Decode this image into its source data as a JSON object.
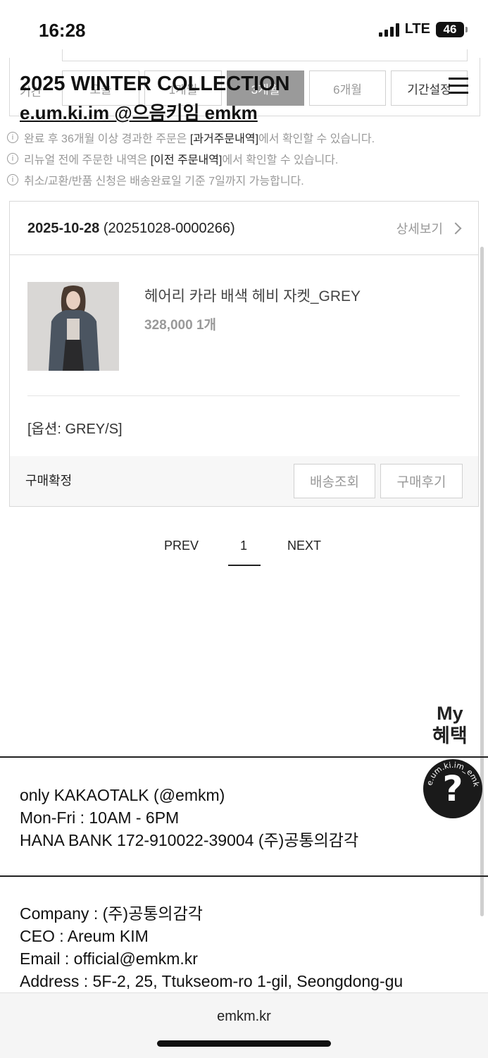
{
  "status_bar": {
    "time": "16:28",
    "network": "LTE",
    "battery": "46"
  },
  "header": {
    "title": "2025 WINTER COLLECTION",
    "subtitle": "e.um.ki.im @으음키임 emkm"
  },
  "period_filter": {
    "label": "기간",
    "options": [
      "오늘",
      "1개월",
      "3개월",
      "6개월",
      "기간설정"
    ],
    "selected": "3개월"
  },
  "notes": [
    {
      "pre": "완료 후 36개월 이상 경과한 주문은 ",
      "link": "[과거주문내역]",
      "post": "에서 확인할 수 있습니다."
    },
    {
      "pre": "리뉴얼 전에 주문한 내역은 ",
      "link": "[이전 주문내역]",
      "post": "에서 확인할 수 있습니다."
    },
    {
      "pre": "취소/교환/반품 신청은 배송완료일 기준 7일까지 가능합니다.",
      "link": "",
      "post": ""
    }
  ],
  "order": {
    "date": "2025-10-28",
    "order_number": "(20251028-0000266)",
    "detail_label": "상세보기",
    "product_name": "헤어리 카라 배색 헤비 자켓_GREY",
    "price": "328,000",
    "quantity": "1개",
    "option": "[옵션: GREY/S]",
    "status": "구매확정",
    "buttons": [
      "배송조회",
      "구매후기"
    ]
  },
  "pagination": {
    "prev": "PREV",
    "page": "1",
    "next": "NEXT"
  },
  "my_benefit": {
    "line1": "My",
    "line2": "혜택"
  },
  "contact": {
    "kakao": "only KAKAOTALK (@emkm)",
    "hours": "Mon-Fri : 10AM - 6PM",
    "bank": "HANA BANK 172-910022-39004 (주)공통의감각"
  },
  "company_info": {
    "company": "Company : (주)공통의감각",
    "ceo": "CEO : Areum KIM",
    "email": "Email : official@emkm.kr",
    "address": "Address : 5F-2, 25, Ttukseom-ro 1-gil, Seongdong-gu"
  },
  "help_button": {
    "label": "?",
    "ring_text": "e.um.ki.im_emkm"
  },
  "browser": {
    "url": "emkm.kr"
  }
}
